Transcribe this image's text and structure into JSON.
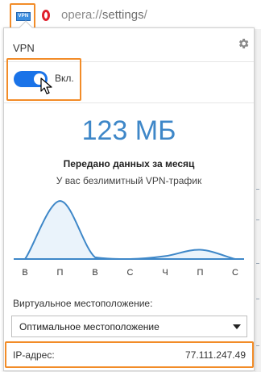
{
  "browser": {
    "vpn_badge": "VPN",
    "url_scheme": "opera://",
    "url_path": "settings",
    "url_tail": "/"
  },
  "popup": {
    "title": "VPN",
    "settings_icon": "gear-icon",
    "toggle": {
      "label": "Вкл.",
      "on": true,
      "color": "#1a73e8"
    },
    "data_used": "123 МБ",
    "data_used_label": "Передано данных за месяц",
    "unlimited_label": "У вас безлимитный VPN-трафик",
    "location_label": "Виртуальное местоположение:",
    "location_value": "Оптимальное местоположение",
    "ip_label": "IP-адрес:",
    "ip_value": "77.111.247.49",
    "accent_color": "#3e87c8",
    "highlight_color": "#f28c28"
  },
  "chart_data": {
    "type": "area",
    "categories": [
      "В",
      "П",
      "В",
      "С",
      "Ч",
      "П",
      "С"
    ],
    "values": [
      0,
      100,
      3,
      0,
      5,
      16,
      0
    ],
    "ylim": [
      0,
      100
    ],
    "grid": false,
    "title": "",
    "xlabel": "",
    "ylabel": ""
  }
}
